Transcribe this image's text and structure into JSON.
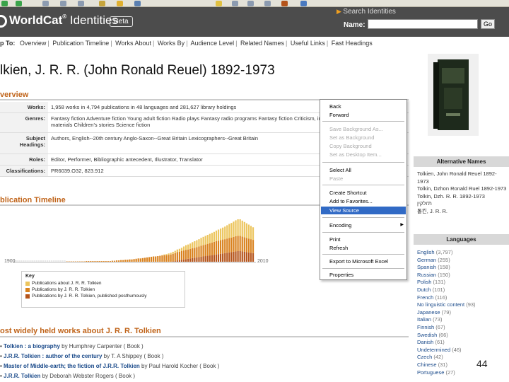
{
  "header": {
    "brand_main": "WorldCat",
    "brand_sup": "®",
    "brand_sub": " Identities",
    "beta": "Beta",
    "search_title": "Search Identities",
    "name_label": "Name:",
    "search_value": "",
    "go_label": "Go"
  },
  "nav": {
    "label": "p To:",
    "items": [
      "Overview",
      "Publication Timeline",
      "Works About",
      "Works By",
      "Audience Level",
      "Related Names",
      "Useful Links",
      "Fast Headings"
    ]
  },
  "title": "lkien, J. R. R. (John Ronald Reuel) 1892-1973",
  "sections": {
    "overview": "verview",
    "timeline": "blication Timeline",
    "works_about": "ost widely held works about J. R. R. Tolkien"
  },
  "overview": [
    {
      "key": "Works:",
      "value": "1,958 works in 4,794 publications in 48 languages and 281,627 library holdings"
    },
    {
      "key": "Genres:",
      "value": "Fantasy fiction  Adventure fiction  Young adult fiction  Radio plays  Fantasy radio programs  Fantasy fiction  Criticism, interpretation, etc  Common language materials  Children's stories  Science fiction"
    },
    {
      "key": "Subject Headings:",
      "value": "Authors, English--20th century  Anglo-Saxon--Great Britain  Lexicographers--Great Britain"
    },
    {
      "key": "Roles:",
      "value": "Editor, Performer, Bibliographic antecedent, Illustrator, Translator"
    },
    {
      "key": "Classifications:",
      "value": "PR6039.O32, 823.912"
    }
  ],
  "timeline": {
    "axis_start": "1900",
    "axis_end": "2010"
  },
  "chart_data": {
    "type": "bar",
    "title": "",
    "xlabel": "",
    "ylabel": "",
    "x_range": [
      "1900",
      "2010"
    ],
    "series": [
      {
        "name": "Publications about J. R. R. Tolkien",
        "color": "#ecc55e",
        "values": [
          0,
          0,
          0,
          0,
          0,
          0,
          0,
          0,
          0,
          0,
          0,
          0,
          0,
          0,
          0,
          0,
          0,
          0,
          0,
          0,
          0,
          0,
          0,
          0,
          0,
          0,
          0,
          0,
          0,
          0,
          0,
          0,
          0,
          0,
          0,
          0,
          0,
          0,
          0,
          0,
          0,
          0,
          0,
          0,
          0,
          0,
          0,
          0,
          0,
          0,
          0,
          0,
          0,
          0,
          0,
          0,
          0,
          0,
          0,
          0,
          0,
          0,
          0,
          0,
          0,
          0,
          0,
          0,
          1,
          2,
          3,
          4,
          5,
          6,
          7,
          8,
          9,
          10,
          12,
          14,
          15,
          16,
          18,
          20,
          21,
          22,
          24,
          25,
          26,
          27,
          28,
          29,
          30,
          32,
          34,
          35,
          36,
          38,
          40,
          42,
          44,
          46,
          48,
          50,
          50,
          48,
          46,
          44,
          42,
          40,
          38
        ]
      },
      {
        "name": "Publications by J. R. R. Tolkien",
        "color": "#d9821f",
        "values": [
          0,
          0,
          0,
          0,
          0,
          0,
          0,
          0,
          0,
          0,
          0,
          0,
          0,
          0,
          0,
          0,
          0,
          0,
          0,
          0,
          0,
          0,
          0,
          0,
          1,
          1,
          1,
          1,
          1,
          1,
          1,
          1,
          1,
          2,
          2,
          2,
          2,
          2,
          2,
          2,
          2,
          2,
          2,
          2,
          2,
          3,
          3,
          4,
          4,
          5,
          5,
          6,
          6,
          7,
          7,
          8,
          9,
          10,
          10,
          11,
          12,
          13,
          14,
          15,
          16,
          16,
          17,
          18,
          19,
          20,
          20,
          21,
          22,
          23,
          24,
          25,
          25,
          26,
          27,
          28,
          28,
          29,
          30,
          30,
          31,
          32,
          33,
          34,
          35,
          36,
          37,
          38,
          39,
          40,
          40,
          41,
          42,
          42,
          43,
          44,
          44,
          45,
          46,
          46,
          46,
          45,
          44,
          43,
          42,
          41,
          40
        ]
      },
      {
        "name": "Publications by J. R. R. Tolkien, published posthumously",
        "color": "#b5541a",
        "values": [
          0,
          0,
          0,
          0,
          0,
          0,
          0,
          0,
          0,
          0,
          0,
          0,
          0,
          0,
          0,
          0,
          0,
          0,
          0,
          0,
          0,
          0,
          0,
          0,
          0,
          0,
          0,
          0,
          0,
          0,
          0,
          0,
          0,
          0,
          0,
          0,
          0,
          0,
          0,
          0,
          0,
          0,
          0,
          0,
          0,
          0,
          0,
          0,
          0,
          0,
          0,
          0,
          0,
          0,
          0,
          0,
          0,
          0,
          0,
          0,
          0,
          0,
          0,
          0,
          0,
          0,
          0,
          0,
          0,
          0,
          0,
          0,
          0,
          1,
          2,
          4,
          5,
          6,
          7,
          8,
          9,
          10,
          11,
          12,
          13,
          14,
          15,
          16,
          17,
          18,
          19,
          20,
          21,
          22,
          23,
          24,
          25,
          26,
          27,
          28,
          29,
          30,
          31,
          32,
          32,
          31,
          30,
          29,
          28,
          27,
          26
        ]
      }
    ]
  },
  "key": {
    "title": "Key",
    "items": [
      {
        "label": "Publications about  J. R. R. Tolkien",
        "color": "#ecc55e"
      },
      {
        "label": "Publications by  J. R. R. Tolkien",
        "color": "#d9821f"
      },
      {
        "label": "Publications by  J. R. R. Tolkien, published posthumously",
        "color": "#b5541a"
      }
    ]
  },
  "works_about": [
    {
      "title": "Tolkien : a biography",
      "author": " by Humphrey Carpenter ( Book )"
    },
    {
      "title": "J.R.R. Tolkien : author of the century",
      "author": " by T. A Shippey ( Book )"
    },
    {
      "title": "Master of Middle-earth; the fiction of J.R.R. Tolkien",
      "author": " by Paul Harold Kocher ( Book )"
    },
    {
      "title": "J.R.R. Tolkien",
      "author": " by Deborah Webster Rogers ( Book )"
    }
  ],
  "right": {
    "alt_names_title": "Alternative Names",
    "alt_names": [
      "Tolkien, John Ronald Reuel 1892-1973",
      "Tolkin, Dzhon Ronald Ruel 1892-1973",
      "Tolkin, Dzh. R. R. 1892-1973",
      "ת'ולקין",
      "톨킨, J. R. R."
    ],
    "languages_title": "Languages",
    "languages": [
      {
        "name": "English",
        "count": "(3,797)"
      },
      {
        "name": "German",
        "count": "(255)"
      },
      {
        "name": "Spanish",
        "count": "(158)"
      },
      {
        "name": "Russian",
        "count": "(150)"
      },
      {
        "name": "Polish",
        "count": "(131)"
      },
      {
        "name": "Dutch",
        "count": "(101)"
      },
      {
        "name": "French",
        "count": "(116)"
      },
      {
        "name": "No linguistic content",
        "count": "(93)"
      },
      {
        "name": "Japanese",
        "count": "(79)"
      },
      {
        "name": "Italian",
        "count": "(73)"
      },
      {
        "name": "Finnish",
        "count": "(67)"
      },
      {
        "name": "Swedish",
        "count": "(66)"
      },
      {
        "name": "Danish",
        "count": "(61)"
      },
      {
        "name": "Undetermined",
        "count": "(46)"
      },
      {
        "name": "Czech",
        "count": "(42)"
      },
      {
        "name": "Chinese",
        "count": "(31)"
      },
      {
        "name": "Portuguese",
        "count": "(27)"
      }
    ]
  },
  "context_menu": {
    "items": [
      {
        "label": "Back",
        "state": "normal"
      },
      {
        "label": "Forward",
        "state": "normal"
      },
      {
        "label": "Save Background As...",
        "state": "disabled"
      },
      {
        "label": "Set as Background",
        "state": "disabled"
      },
      {
        "label": "Copy Background",
        "state": "disabled"
      },
      {
        "label": "Set as Desktop Item...",
        "state": "disabled"
      },
      {
        "label": "Select All",
        "state": "normal"
      },
      {
        "label": "Paste",
        "state": "disabled"
      },
      {
        "label": "Create Shortcut",
        "state": "normal"
      },
      {
        "label": "Add to Favorites...",
        "state": "normal"
      },
      {
        "label": "View Source",
        "state": "selected"
      },
      {
        "label": "Encoding",
        "state": "submenu"
      },
      {
        "label": "Print",
        "state": "normal"
      },
      {
        "label": "Refresh",
        "state": "normal"
      },
      {
        "label": "Export to Microsoft Excel",
        "state": "normal"
      },
      {
        "label": "Properties",
        "state": "normal"
      }
    ]
  },
  "slide_number": "44"
}
